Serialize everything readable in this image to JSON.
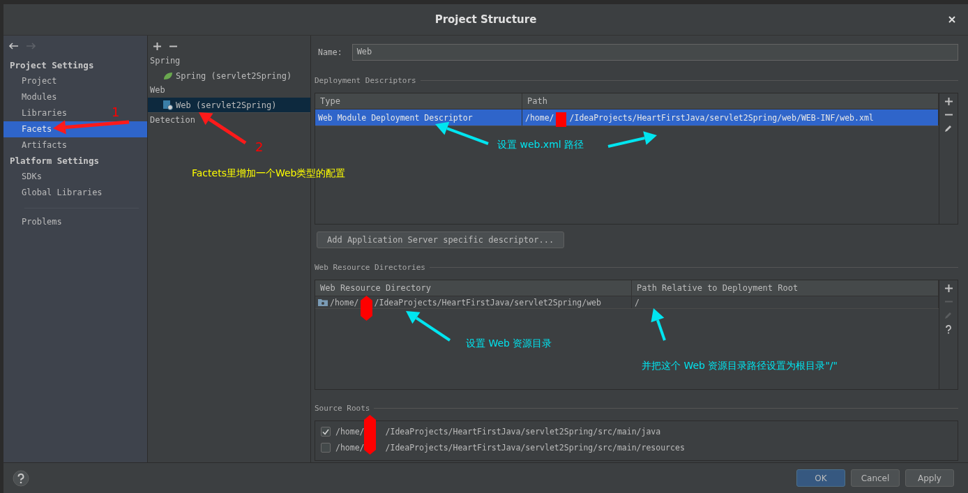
{
  "window": {
    "title": "Project Structure"
  },
  "nav": {
    "sections": [
      {
        "title": "Project Settings",
        "items": [
          {
            "label": "Project",
            "selected": false
          },
          {
            "label": "Modules",
            "selected": false
          },
          {
            "label": "Libraries",
            "selected": false
          },
          {
            "label": "Facets",
            "selected": true
          },
          {
            "label": "Artifacts",
            "selected": false
          }
        ]
      },
      {
        "title": "Platform Settings",
        "items": [
          {
            "label": "SDKs",
            "selected": false
          },
          {
            "label": "Global Libraries",
            "selected": false
          }
        ]
      }
    ],
    "footer_items": [
      {
        "label": "Problems",
        "selected": false
      }
    ]
  },
  "facets": {
    "groups": [
      {
        "label": "Spring",
        "children": [
          {
            "label": "Spring (servlet2Spring)",
            "kind": "spring",
            "selected": false
          }
        ]
      },
      {
        "label": "Web",
        "children": [
          {
            "label": "Web (servlet2Spring)",
            "kind": "web",
            "selected": true
          }
        ]
      },
      {
        "label": "Detection"
      }
    ]
  },
  "name": {
    "label": "Name:",
    "value": "Web"
  },
  "deployment_descriptors": {
    "title": "Deployment Descriptors",
    "columns": [
      "Type",
      "Path"
    ],
    "rows": [
      {
        "type": "Web Module Deployment Descriptor",
        "path_start": "/home/",
        "path_end": "/IdeaProjects/HeartFirstJava/servlet2Spring/web/WEB-INF/web.xml",
        "selected": true
      }
    ],
    "tools": [
      {
        "kind": "add",
        "disabled": false
      },
      {
        "kind": "remove",
        "disabled": false
      },
      {
        "kind": "edit",
        "disabled": false
      }
    ],
    "add_button": "Add Application Server specific descriptor..."
  },
  "web_resource_directories": {
    "title": "Web Resource Directories",
    "columns": [
      "Web Resource Directory",
      "Path Relative to Deployment Root"
    ],
    "rows": [
      {
        "directory_start": "/home/",
        "directory_end": "/IdeaProjects/HeartFirstJava/servlet2Spring/web",
        "relative_path": "/",
        "selected": false
      }
    ],
    "tools": [
      {
        "kind": "add",
        "disabled": false
      },
      {
        "kind": "remove",
        "disabled": true
      },
      {
        "kind": "edit",
        "disabled": true
      },
      {
        "kind": "help",
        "disabled": false
      }
    ]
  },
  "source_roots": {
    "title": "Source Roots",
    "items": [
      {
        "path_start": "/home/",
        "path_end": "/IdeaProjects/HeartFirstJava/servlet2Spring/src/main/java",
        "checked": true
      },
      {
        "path_start": "/home/",
        "path_end": "/IdeaProjects/HeartFirstJava/servlet2Spring/src/main/resources",
        "checked": false
      }
    ]
  },
  "buttons": [
    {
      "label": "OK",
      "default": true
    },
    {
      "label": "Cancel",
      "default": false
    },
    {
      "label": "Apply",
      "default": false
    }
  ],
  "annotations": [
    {
      "text": "1",
      "color": "#ff0000"
    },
    {
      "text": "2",
      "color": "#ff0000"
    },
    {
      "text": "Factets里增加一个Web类型的配置",
      "color": "#ffff00"
    },
    {
      "text": "设置 web.xml  路径",
      "color": "#00e5f0"
    },
    {
      "text": "设置 Web 资源目录",
      "color": "#00e5f0"
    },
    {
      "text": "并把这个 Web 资源目录路径设置为根目录\"/\"",
      "color": "#00e5f0"
    }
  ]
}
